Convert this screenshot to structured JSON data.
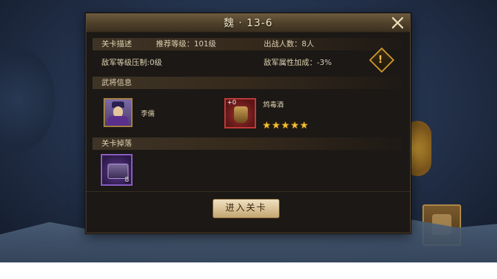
{
  "dialog": {
    "title": "魏 · 13-6",
    "close_icon": "close-x-icon"
  },
  "description": {
    "section_label": "关卡描述",
    "recommended_level_label": "推荐等级",
    "recommended_level_value": "101级",
    "troops_label": "出战人数",
    "troops_value": "8人",
    "level_suppression_label": "敌军等级压制",
    "level_suppression_value": "0级",
    "attribute_bonus_label": "敌军属性加成",
    "attribute_bonus_value": "-3%",
    "warning_icon": "exclamation-warning-icon"
  },
  "generals": {
    "section_label": "武将信息",
    "list": [
      {
        "name": "李儒",
        "icon": "general-portrait-icon"
      },
      {
        "name": "鸩毒酒",
        "level_badge": "+0",
        "stars": 5,
        "icon": "poison-wine-item-icon"
      }
    ]
  },
  "drops": {
    "section_label": "关卡掉落",
    "items": [
      {
        "icon": "treasure-chest-icon",
        "count": "8"
      }
    ]
  },
  "actions": {
    "enter_label": "进入关卡"
  },
  "colors": {
    "title_text": "#f3e7c8",
    "star": "#f2c033",
    "warning": "#c9952c",
    "button_bg": "#d9c196"
  }
}
